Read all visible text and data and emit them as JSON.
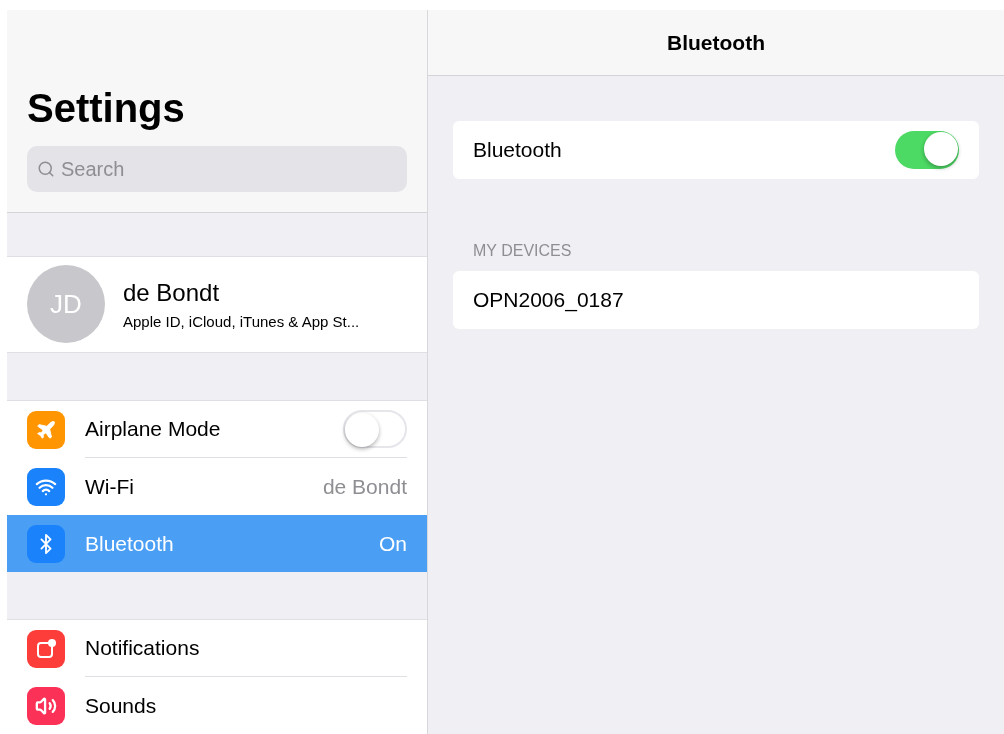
{
  "sidebar": {
    "title": "Settings",
    "search": {
      "placeholder": "Search"
    },
    "profile": {
      "initials": "JD",
      "name": "de Bondt",
      "subtitle": "Apple ID, iCloud, iTunes & App St..."
    },
    "groups": [
      {
        "items": [
          {
            "label": "Airplane Mode",
            "kind": "toggle",
            "on": false,
            "selected": false,
            "color": "#ff9500"
          },
          {
            "label": "Wi-Fi",
            "kind": "value",
            "value": "de Bondt",
            "selected": false,
            "color": "#1a82fb"
          },
          {
            "label": "Bluetooth",
            "kind": "value",
            "value": "On",
            "selected": true,
            "color": "#1a82fb"
          }
        ]
      },
      {
        "items": [
          {
            "label": "Notifications",
            "kind": "plain",
            "selected": false,
            "color": "#fc3d39"
          },
          {
            "label": "Sounds",
            "kind": "plain",
            "selected": false,
            "color": "#fc3158"
          }
        ]
      }
    ]
  },
  "detail": {
    "title": "Bluetooth",
    "main_toggle": {
      "label": "Bluetooth",
      "on": true
    },
    "section_header": "MY DEVICES",
    "devices": [
      {
        "name": "OPN2006_0187"
      }
    ]
  }
}
